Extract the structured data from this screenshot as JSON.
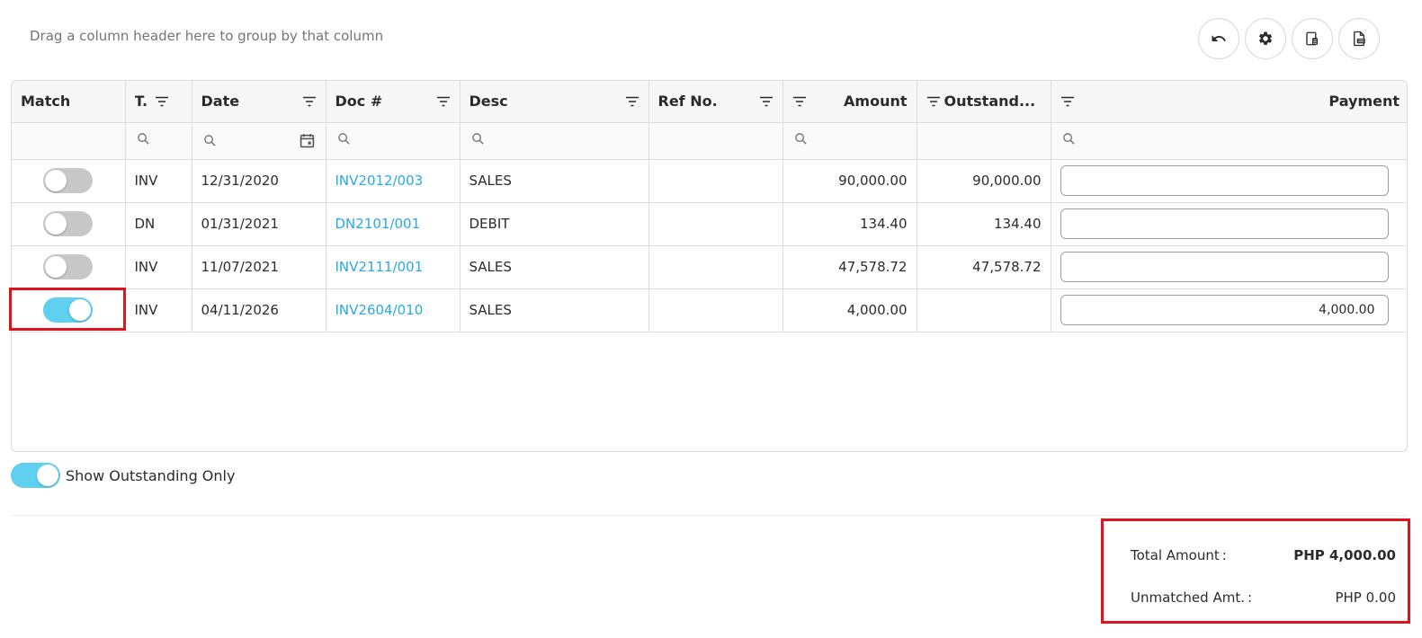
{
  "group_hint": "Drag a column header here to group by that column",
  "toolbar": {
    "buttons": [
      {
        "icon": "undo-icon"
      },
      {
        "icon": "gear-icon"
      },
      {
        "icon": "column-chooser-icon"
      },
      {
        "icon": "export-icon"
      }
    ]
  },
  "columns": {
    "match": "Match",
    "type": "T.",
    "date": "Date",
    "doc": "Doc #",
    "desc": "Desc",
    "ref": "Ref No.",
    "amount": "Amount",
    "outstanding": "Outstand...",
    "payment": "Payment"
  },
  "rows": [
    {
      "match": false,
      "type": "INV",
      "date": "12/31/2020",
      "doc": "INV2012/003",
      "desc": "SALES",
      "ref": "",
      "amount": "90,000.00",
      "outstanding": "90,000.00",
      "payment": ""
    },
    {
      "match": false,
      "type": "DN",
      "date": "01/31/2021",
      "doc": "DN2101/001",
      "desc": "DEBIT",
      "ref": "",
      "amount": "134.40",
      "outstanding": "134.40",
      "payment": ""
    },
    {
      "match": false,
      "type": "INV",
      "date": "11/07/2021",
      "doc": "INV2111/001",
      "desc": "SALES",
      "ref": "",
      "amount": "47,578.72",
      "outstanding": "47,578.72",
      "payment": ""
    },
    {
      "match": true,
      "type": "INV",
      "date": "04/11/2026",
      "doc": "INV2604/010",
      "desc": "SALES",
      "ref": "",
      "amount": "4,000.00",
      "outstanding": "",
      "payment": "4,000.00"
    }
  ],
  "show_outstanding": {
    "label": "Show Outstanding Only",
    "on": true
  },
  "totals": {
    "total_label": "Total Amount :",
    "total_value": "PHP 4,000.00",
    "unmatched_label": "Unmatched Amt. :",
    "unmatched_value": "PHP 0.00"
  },
  "colors": {
    "accent": "#29a9e6",
    "toggle_on": "#5fd0f0",
    "highlight": "#e0141e"
  }
}
